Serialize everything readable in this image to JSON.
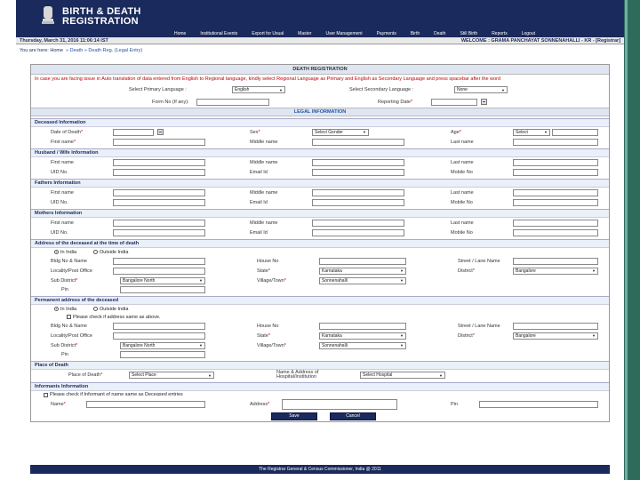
{
  "header": {
    "logo_text_line1": "BIRTH & DEATH",
    "logo_text_line2": "REGISTRATION",
    "menu": [
      "Home",
      "Institutional Events",
      "Export for Usual",
      "Master",
      "User Management",
      "Payments",
      "Birth",
      "Death",
      "Still Birth",
      "Reports",
      "Logout"
    ]
  },
  "infobar": {
    "datetime": "Thursday, March 31, 2016 11:06:14 IST",
    "welcome": "WELCOME : GRAMA PANCHAYAT SONNENAHALLI - KR - [Registrar]"
  },
  "breadcrumb": {
    "prefix": "You are here: Home",
    "trail": "» Death » Death Reg. (Legal Entry)"
  },
  "form": {
    "title": "DEATH REGISTRATION",
    "notice": "In case you are facing issue in Auto translation of data entered from English to Regional language, kindly select Regional Language as Primary and English as Secondary Language and press spacebar after the word",
    "primary_lang_label": "Select Primary Language :",
    "primary_lang_value": "English",
    "secondary_lang_label": "Select Secondary Language :",
    "secondary_lang_value": "None",
    "form_no_label": "Form No (If any):",
    "reporting_date_label": "Reporting Date",
    "legal_info": "LEGAL INFORMATION"
  },
  "deceased": {
    "head": "Deceased Information",
    "date_of_death": "Date of Death",
    "sex": "Sex",
    "sex_value": "Select Gender",
    "age": "Age",
    "age_value": "Select",
    "first_name": "First name",
    "middle_name": "Middle name",
    "last_name": "Last name"
  },
  "husband": {
    "head": "Husband / Wife Information",
    "first_name": "First name",
    "middle_name": "Middle name",
    "last_name": "Last name",
    "uid": "UID No.",
    "email": "Email Id",
    "mobile": "Mobile No"
  },
  "father": {
    "head": "Fathers Information",
    "first_name": "First name",
    "middle_name": "Middle name",
    "last_name": "Last name",
    "uid": "UID No.",
    "email": "Email Id",
    "mobile": "Mobile No"
  },
  "mother": {
    "head": "Mothers Information",
    "first_name": "First name",
    "middle_name": "Middle name",
    "last_name": "Last name",
    "uid": "UID No.",
    "email": "Email Id",
    "mobile": "Mobile No"
  },
  "address_death": {
    "head": "Address of the deceased at the time of death",
    "in_india": "In India",
    "outside_india": "Outside India",
    "bldg": "Bldg No & Name",
    "house": "House No",
    "street": "Street / Lane Name",
    "locality": "Locality/Post Office",
    "state": "State",
    "state_value": "Karnataka",
    "district": "District",
    "district_value": "Bangalore",
    "subdistrict": "Sub District",
    "subdistrict_value": "Bangalore North",
    "village": "Village/Town",
    "village_value": "Sonnenahalli",
    "pin": "Pin"
  },
  "address_perm": {
    "head": "Permanent address of the deceased",
    "in_india": "In India",
    "outside_india": "Outside India",
    "same_as": "Please check if address same as above.",
    "bldg": "Bldg No & Name",
    "house": "House No",
    "street": "Street / Lane Name",
    "locality": "Locality/Post Office",
    "state": "State",
    "state_value": "Karnataka",
    "district": "District",
    "district_value": "Bangalore",
    "subdistrict": "Sub District",
    "subdistrict_value": "Bangalore North",
    "village": "Village/Town",
    "village_value": "Sonnenahalli",
    "pin": "Pin"
  },
  "place_of_death": {
    "head": "Place of Death",
    "place_label": "Place of Death",
    "place_value": "Select Place",
    "hospital_label": "Name & Address of Hospital/Institution",
    "hospital_value": "Select Hospital"
  },
  "informant": {
    "head": "Informants Information",
    "check_label": "Please check if Informant of name same as Deceased entries",
    "name": "Name",
    "address": "Address",
    "pin": "Pin"
  },
  "buttons": {
    "save": "Save",
    "cancel": "Cancel"
  },
  "footer": "The Registrar General & Census Commissioner, India @ 2011"
}
